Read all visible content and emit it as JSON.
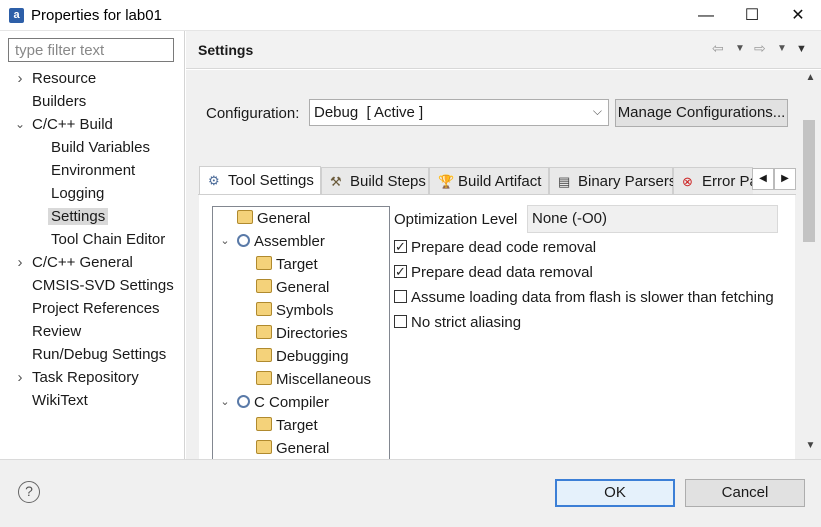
{
  "window": {
    "title": "Properties for lab01",
    "minimize_glyph": "—",
    "maximize_glyph": "☐",
    "close_glyph": "✕"
  },
  "filter": {
    "placeholder": "type filter text",
    "value": ""
  },
  "nav": [
    {
      "label": "Resource",
      "expandable": true,
      "expanded": false
    },
    {
      "label": "Builders"
    },
    {
      "label": "C/C++ Build",
      "expandable": true,
      "expanded": true
    },
    {
      "label": "Build Variables",
      "child": true
    },
    {
      "label": "Environment",
      "child": true
    },
    {
      "label": "Logging",
      "child": true
    },
    {
      "label": "Settings",
      "child": true,
      "selected": true
    },
    {
      "label": "Tool Chain Editor",
      "child": true
    },
    {
      "label": "C/C++ General",
      "expandable": true,
      "expanded": false
    },
    {
      "label": "CMSIS-SVD Settings"
    },
    {
      "label": "Project References"
    },
    {
      "label": "Review"
    },
    {
      "label": "Run/Debug Settings"
    },
    {
      "label": "Task Repository",
      "expandable": true,
      "expanded": false
    },
    {
      "label": "WikiText"
    }
  ],
  "header": {
    "title": "Settings"
  },
  "config": {
    "label": "Configuration:",
    "value": "Debug  [ Active ]",
    "manage_label": "Manage Configurations..."
  },
  "tabs": [
    {
      "label": "Tool Settings",
      "icon": "gear-icon",
      "active": true
    },
    {
      "label": "Build Steps",
      "icon": "hammer-icon"
    },
    {
      "label": "Build Artifact",
      "icon": "trophy-icon"
    },
    {
      "label": "Binary Parsers",
      "icon": "binary-icon"
    },
    {
      "label": "Error Pa",
      "icon": "error-icon"
    }
  ],
  "tree": [
    {
      "label": "General",
      "icon": "folder",
      "level": 0
    },
    {
      "label": "Assembler",
      "icon": "gear",
      "level": 0,
      "expanded": true
    },
    {
      "label": "Target",
      "icon": "folder",
      "level": 1
    },
    {
      "label": "General",
      "icon": "folder",
      "level": 1
    },
    {
      "label": "Symbols",
      "icon": "folder",
      "level": 1
    },
    {
      "label": "Directories",
      "icon": "folder",
      "level": 1
    },
    {
      "label": "Debugging",
      "icon": "folder",
      "level": 1
    },
    {
      "label": "Miscellaneous",
      "icon": "folder",
      "level": 1
    },
    {
      "label": "C Compiler",
      "icon": "gear",
      "level": 0,
      "expanded": true
    },
    {
      "label": "Target",
      "icon": "folder",
      "level": 1
    },
    {
      "label": "General",
      "icon": "folder",
      "level": 1
    }
  ],
  "optimization": {
    "label": "Optimization Level",
    "value": "None (-O0)"
  },
  "options": [
    {
      "label": "Prepare dead code removal",
      "checked": true
    },
    {
      "label": "Prepare dead data removal",
      "checked": true
    },
    {
      "label": "Assume loading data from flash is slower than fetching",
      "checked": false
    },
    {
      "label": "No strict aliasing",
      "checked": false
    }
  ],
  "footer": {
    "help": "?",
    "ok_label": "OK",
    "cancel_label": "Cancel"
  },
  "colors": {
    "accent": "#3c7fd6",
    "selection": "#d9d9d9"
  }
}
